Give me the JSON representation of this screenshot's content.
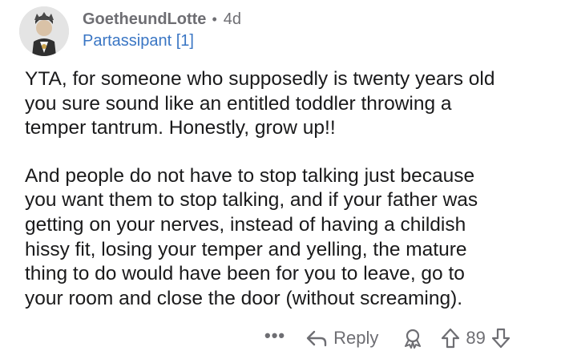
{
  "comment": {
    "username": "GoetheundLotte",
    "separator": "•",
    "age": "4d",
    "flair": "Partassipant [1]",
    "paragraphs": [
      "YTA, for someone who supposedly is twenty years old\nyou sure sound like an entitled toddler throwing a\ntemper tantrum.  Honestly, grow up!!",
      "And people do not have to stop talking just because\nyou want them to stop talking, and if your father was\ngetting on your nerves, instead of having a childish\nhissy fit, losing your temper and yelling, the mature\nthing to do would have been for you to leave, go to\nyour room and close the door (without screaming)."
    ]
  },
  "actions": {
    "more_label": "•••",
    "reply_label": "Reply",
    "vote_count": "89"
  },
  "icons": {
    "avatar": "avatar",
    "reply": "reply-arrow-icon",
    "award": "award-icon",
    "upvote": "upvote-icon",
    "downvote": "downvote-icon"
  },
  "colors": {
    "text": "#1a1a1b",
    "meta": "#6e6e73",
    "flair": "#3a76c4"
  }
}
